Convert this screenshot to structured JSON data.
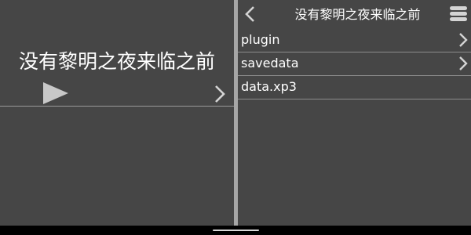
{
  "game": {
    "title": "没有黎明之夜来临之前"
  },
  "browser": {
    "header_title": "没有黎明之夜来临之前",
    "entries": [
      {
        "name": "plugin",
        "is_folder": true
      },
      {
        "name": "savedata",
        "is_folder": true
      },
      {
        "name": "data.xp3",
        "is_folder": false
      }
    ]
  },
  "icons": {
    "play": "play-icon",
    "back": "chevron-left-icon",
    "menu": "hamburger-menu-icon",
    "folder_arrow": "chevron-right-icon"
  },
  "colors": {
    "background": "#464646",
    "splitter": "#a6a6a6",
    "text": "#ffffff",
    "icon": "#d4d4d4"
  }
}
